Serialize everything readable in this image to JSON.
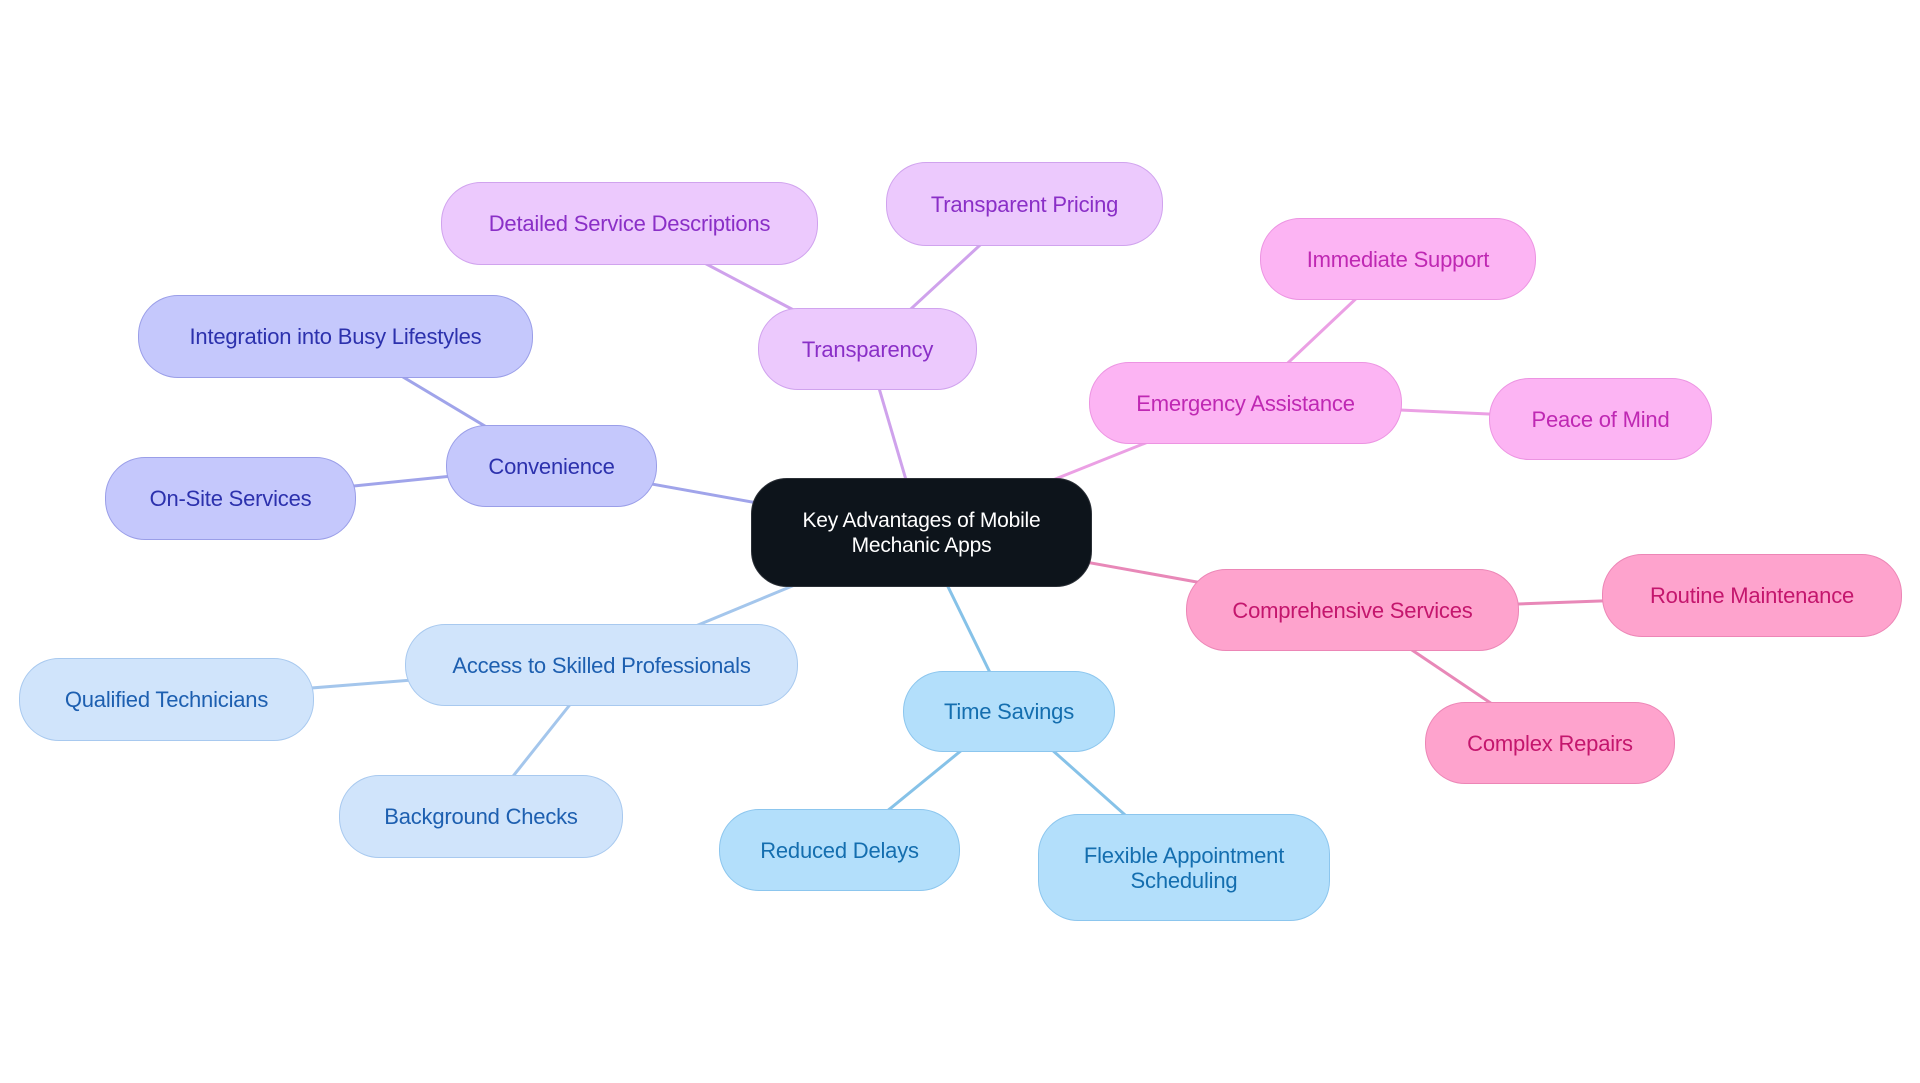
{
  "diagram": {
    "type": "mind-map",
    "root": {
      "id": "root",
      "label": "Key Advantages of Mobile Mechanic Apps",
      "lines": [
        "Key Advantages of Mobile",
        "Mechanic Apps"
      ],
      "color": "#0d141b"
    },
    "branches": [
      {
        "id": "convenience",
        "label": "Convenience",
        "colors": {
          "fill": "#c5c8fc",
          "border": "#9a9ee8",
          "text": "#2c31ad",
          "edge": "#a0a4ea"
        },
        "children": [
          {
            "id": "integration",
            "label": "Integration into Busy Lifestyles"
          },
          {
            "id": "onsite",
            "label": "On-Site Services"
          }
        ]
      },
      {
        "id": "transparency",
        "label": "Transparency",
        "colors": {
          "fill": "#ecc9fd",
          "border": "#d0a3ee",
          "text": "#8a2fc7",
          "edge": "#cfa2ec"
        },
        "children": [
          {
            "id": "detailed",
            "label": "Detailed Service Descriptions"
          },
          {
            "id": "pricing",
            "label": "Transparent Pricing"
          }
        ]
      },
      {
        "id": "emergency",
        "label": "Emergency Assistance",
        "colors": {
          "fill": "#fcb4f3",
          "border": "#ec94e2",
          "text": "#bf28b3",
          "edge": "#eba0e4"
        },
        "children": [
          {
            "id": "immediate",
            "label": "Immediate Support"
          },
          {
            "id": "peace",
            "label": "Peace of Mind"
          }
        ]
      },
      {
        "id": "comprehensive",
        "label": "Comprehensive Services",
        "colors": {
          "fill": "#fea3cd",
          "border": "#ec86b6",
          "text": "#c4166d",
          "edge": "#e888b8"
        },
        "children": [
          {
            "id": "routine",
            "label": "Routine Maintenance"
          },
          {
            "id": "complex",
            "label": "Complex Repairs"
          }
        ]
      },
      {
        "id": "timesavings",
        "label": "Time Savings",
        "colors": {
          "fill": "#b3dffb",
          "border": "#8cc6ee",
          "text": "#146eaf",
          "edge": "#86c2e8"
        },
        "children": [
          {
            "id": "reduced",
            "label": "Reduced Delays"
          },
          {
            "id": "flexible",
            "label": "Flexible Appointment Scheduling",
            "lines": [
              "Flexible Appointment",
              "Scheduling"
            ]
          }
        ]
      },
      {
        "id": "access",
        "label": "Access to Skilled Professionals",
        "colors": {
          "fill": "#d0e4fb",
          "border": "#a8c9ef",
          "text": "#1d5fb0",
          "edge": "#a4c6ec"
        },
        "children": [
          {
            "id": "qualified",
            "label": "Qualified Technicians"
          },
          {
            "id": "background",
            "label": "Background Checks"
          }
        ]
      }
    ]
  }
}
